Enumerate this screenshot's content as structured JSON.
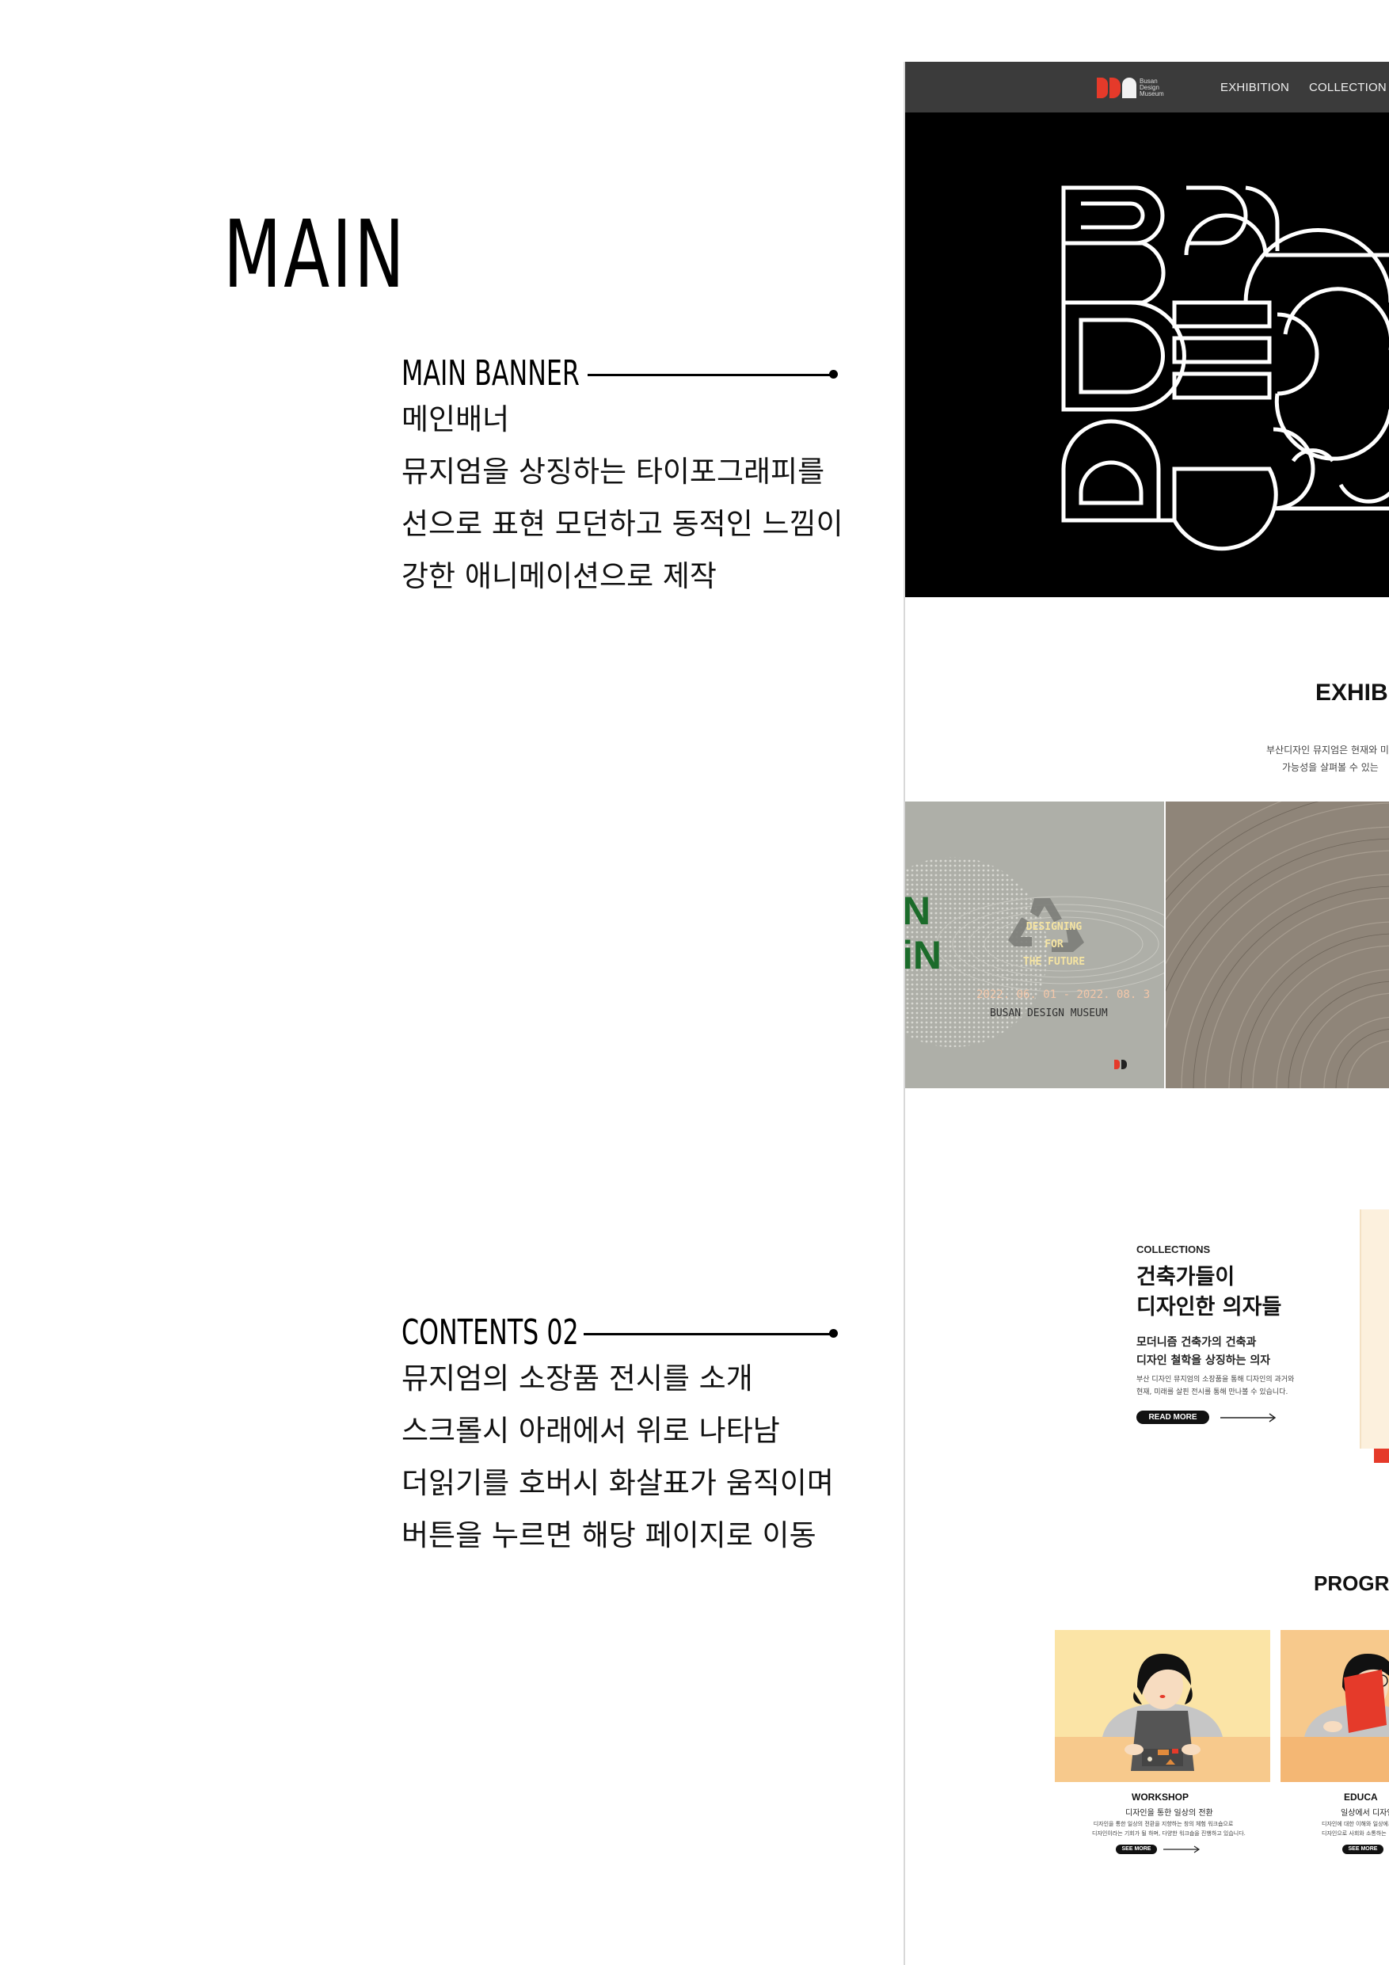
{
  "page_title": "MAIN",
  "annotations": {
    "main_banner": {
      "title": "MAIN BANNER",
      "lines": [
        "메인배너",
        "뮤지엄을 상징하는 타이포그래피를",
        "선으로 표현 모던하고 동적인 느낌이",
        "강한 애니메이션으로 제작"
      ]
    },
    "contents_02": {
      "title": "CONTENTS 02",
      "lines": [
        "뮤지엄의 소장품 전시를 소개",
        "스크롤시 아래에서 위로 나타남",
        "더읽기를 호버시 화살표가 움직이며",
        "버튼을 누르면 해당 페이지로 이동"
      ]
    }
  },
  "mockup": {
    "nav": {
      "logo_text": [
        "Busan",
        "Design",
        "Museum"
      ],
      "items": [
        "EXHIBITION",
        "COLLECTION"
      ]
    },
    "exhibition": {
      "title": "EXHIBI",
      "desc": [
        "부산디자인 뮤지엄은 현재와 미",
        "가능성을 살펴볼 수 있는"
      ]
    },
    "exhibition_card": {
      "headline_fragments": [
        "N",
        "iN"
      ],
      "label": [
        "DESIGNING",
        "FOR",
        "THE FUTURE"
      ],
      "dates": "2022. 06. 01 - 2022. 08. 3",
      "venue": "BUSAN DESIGN MUSEUM"
    },
    "collections": {
      "small_label": "COLLECTIONS",
      "title_lines": [
        "건축가들이",
        "디자인한 의자들"
      ],
      "sub_lines": [
        "모더니즘 건축가의 건축과",
        "디자인 철학을 상징하는 의자"
      ],
      "desc_lines": [
        "부산 디자인 뮤지엄의 소장품을 통해 디자인의 과거와",
        "현재, 미래를 살핀 전시를 통해 만나볼 수 있습니다."
      ],
      "button": "READ MORE"
    },
    "program": {
      "title": "PROGRA",
      "cards": [
        {
          "title": "WORKSHOP",
          "sub": "디자인을 통한 일상의 전환",
          "desc": [
            "디자인을 통한 일상의 전환을 지향하는 창의 체험 워크숍으로",
            "디자인이라는 기회가 될 하며, 다양한 워크숍을 진행하고 있습니다."
          ],
          "button": "SEE MORE"
        },
        {
          "title": "EDUCA",
          "sub": "일상에서 디자인",
          "desc": [
            "디자인에 대한 이해와 일상에서",
            "디자인으로 사회와 소통하는"
          ],
          "button": "SEE MORE"
        }
      ]
    }
  }
}
